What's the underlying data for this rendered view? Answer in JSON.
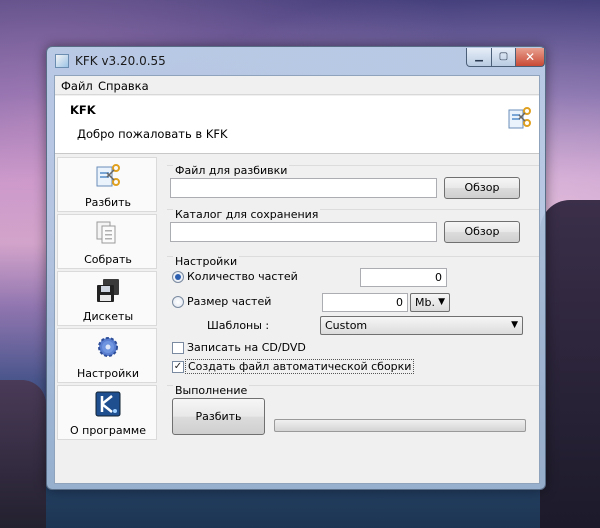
{
  "window": {
    "title": "KFK v3.20.0.55"
  },
  "menu": {
    "file": "Файл",
    "help": "Справка"
  },
  "header": {
    "title": "KFK",
    "subtitle": "Добро пожаловать в KFK"
  },
  "sidebar": {
    "items": [
      {
        "label": "Разбить",
        "icon": "split-scissors-icon"
      },
      {
        "label": "Собрать",
        "icon": "assemble-documents-icon"
      },
      {
        "label": "Дискеты",
        "icon": "floppy-disks-icon"
      },
      {
        "label": "Настройки",
        "icon": "gear-icon"
      },
      {
        "label": "О программе",
        "icon": "kfk-logo-icon"
      }
    ]
  },
  "file_group": {
    "label": "Файл для разбивки",
    "value": "",
    "browse": "Обзор"
  },
  "folder_group": {
    "label": "Каталог для сохранения",
    "value": "",
    "browse": "Обзор"
  },
  "settings": {
    "label": "Настройки",
    "parts_count_label": "Количество частей",
    "parts_count_value": "0",
    "part_size_label": "Размер частей",
    "part_size_value": "0",
    "part_size_unit": "Mb.",
    "templates_label": "Шаблоны :",
    "templates_value": "Custom",
    "burn_cd_label": "Записать на CD/DVD",
    "auto_assembly_label": "Создать файл автоматической сборки"
  },
  "execution": {
    "label": "Выполнение",
    "split_button": "Разбить",
    "progress": 0
  },
  "colors": {
    "accent": "#2c5fb0",
    "close": "#c84a36"
  }
}
